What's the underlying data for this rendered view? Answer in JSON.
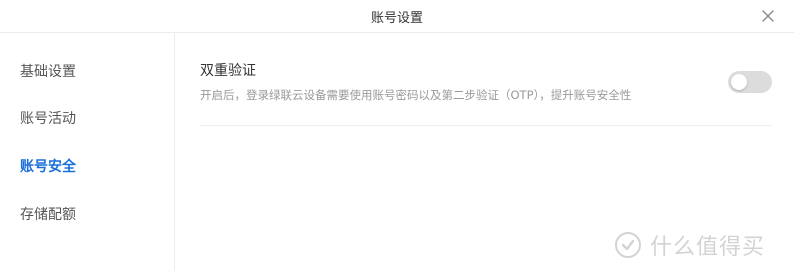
{
  "window": {
    "title": "账号设置"
  },
  "sidebar": {
    "items": [
      {
        "label": "基础设置",
        "active": false
      },
      {
        "label": "账号活动",
        "active": false
      },
      {
        "label": "账号安全",
        "active": true
      },
      {
        "label": "存储配额",
        "active": false
      }
    ]
  },
  "main": {
    "setting": {
      "title": "双重验证",
      "description": "开启后，登录绿联云设备需要使用账号密码以及第二步验证（OTP），提升账号安全性",
      "toggle_on": false
    }
  },
  "watermark": {
    "text": "什么值得买"
  },
  "colors": {
    "active": "#1a6fd8",
    "toggle_off": "#dcdcdc",
    "divider": "#eeeeee"
  },
  "icons": {
    "close": "close-icon",
    "watermark_logo": "smzdm-logo-icon"
  }
}
